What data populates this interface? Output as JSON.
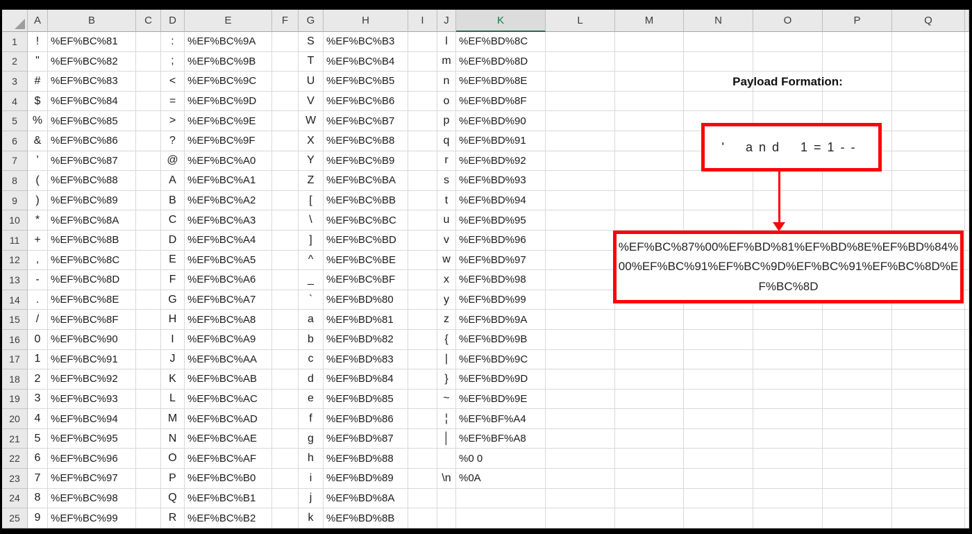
{
  "sheet": {
    "columns": [
      "A",
      "B",
      "C",
      "D",
      "E",
      "F",
      "G",
      "H",
      "I",
      "J",
      "K",
      "L",
      "M",
      "N",
      "O",
      "P",
      "Q"
    ],
    "selected_column": "K",
    "rows": [
      {
        "n": "1",
        "A": "!",
        "B": "%EF%BC%81",
        "D": ":",
        "E": "%EF%BC%9A",
        "G": "S",
        "H": "%EF%BC%B3",
        "J": "l",
        "K": "%EF%BD%8C"
      },
      {
        "n": "2",
        "A": "\"",
        "B": "%EF%BC%82",
        "D": ";",
        "E": "%EF%BC%9B",
        "G": "T",
        "H": "%EF%BC%B4",
        "J": "m",
        "K": "%EF%BD%8D"
      },
      {
        "n": "3",
        "A": "#",
        "B": "%EF%BC%83",
        "D": "<",
        "E": "%EF%BC%9C",
        "G": "U",
        "H": "%EF%BC%B5",
        "J": "n",
        "K": "%EF%BD%8E"
      },
      {
        "n": "4",
        "A": "$",
        "B": "%EF%BC%84",
        "D": "=",
        "E": "%EF%BC%9D",
        "G": "V",
        "H": "%EF%BC%B6",
        "J": "o",
        "K": "%EF%BD%8F"
      },
      {
        "n": "5",
        "A": "%",
        "B": "%EF%BC%85",
        "D": ">",
        "E": "%EF%BC%9E",
        "G": "W",
        "H": "%EF%BC%B7",
        "J": "p",
        "K": "%EF%BD%90"
      },
      {
        "n": "6",
        "A": "&",
        "B": "%EF%BC%86",
        "D": "?",
        "E": "%EF%BC%9F",
        "G": "X",
        "H": "%EF%BC%B8",
        "J": "q",
        "K": "%EF%BD%91"
      },
      {
        "n": "7",
        "A": "'",
        "B": "%EF%BC%87",
        "D": "@",
        "E": "%EF%BC%A0",
        "G": "Y",
        "H": "%EF%BC%B9",
        "J": "r",
        "K": "%EF%BD%92"
      },
      {
        "n": "8",
        "A": "(",
        "B": "%EF%BC%88",
        "D": "A",
        "E": "%EF%BC%A1",
        "G": "Z",
        "H": "%EF%BC%BA",
        "J": "s",
        "K": "%EF%BD%93"
      },
      {
        "n": "9",
        "A": ")",
        "B": "%EF%BC%89",
        "D": "B",
        "E": "%EF%BC%A2",
        "G": "[",
        "H": "%EF%BC%BB",
        "J": "t",
        "K": "%EF%BD%94"
      },
      {
        "n": "10",
        "A": "*",
        "B": "%EF%BC%8A",
        "D": "C",
        "E": "%EF%BC%A3",
        "G": "\\",
        "H": "%EF%BC%BC",
        "J": "u",
        "K": "%EF%BD%95"
      },
      {
        "n": "11",
        "A": "+",
        "B": "%EF%BC%8B",
        "D": "D",
        "E": "%EF%BC%A4",
        "G": "]",
        "H": "%EF%BC%BD",
        "J": "v",
        "K": "%EF%BD%96"
      },
      {
        "n": "12",
        "A": ",",
        "B": "%EF%BC%8C",
        "D": "E",
        "E": "%EF%BC%A5",
        "G": "^",
        "H": "%EF%BC%BE",
        "J": "w",
        "K": "%EF%BD%97"
      },
      {
        "n": "13",
        "A": "-",
        "B": "%EF%BC%8D",
        "D": "F",
        "E": "%EF%BC%A6",
        "G": "_",
        "H": "%EF%BC%BF",
        "J": "x",
        "K": "%EF%BD%98"
      },
      {
        "n": "14",
        "A": ".",
        "B": "%EF%BC%8E",
        "D": "G",
        "E": "%EF%BC%A7",
        "G": "`",
        "H": "%EF%BD%80",
        "J": "y",
        "K": "%EF%BD%99"
      },
      {
        "n": "15",
        "A": "/",
        "B": "%EF%BC%8F",
        "D": "H",
        "E": "%EF%BC%A8",
        "G": "a",
        "H": "%EF%BD%81",
        "J": "z",
        "K": "%EF%BD%9A"
      },
      {
        "n": "16",
        "A": "0",
        "B": "%EF%BC%90",
        "D": "I",
        "E": "%EF%BC%A9",
        "G": "b",
        "H": "%EF%BD%82",
        "J": "{",
        "K": "%EF%BD%9B"
      },
      {
        "n": "17",
        "A": "1",
        "B": "%EF%BC%91",
        "D": "J",
        "E": "%EF%BC%AA",
        "G": "c",
        "H": "%EF%BD%83",
        "J": "|",
        "K": "%EF%BD%9C"
      },
      {
        "n": "18",
        "A": "2",
        "B": "%EF%BC%92",
        "D": "K",
        "E": "%EF%BC%AB",
        "G": "d",
        "H": "%EF%BD%84",
        "J": "}",
        "K": "%EF%BD%9D"
      },
      {
        "n": "19",
        "A": "3",
        "B": "%EF%BC%93",
        "D": "L",
        "E": "%EF%BC%AC",
        "G": "e",
        "H": "%EF%BD%85",
        "J": "~",
        "K": "%EF%BD%9E"
      },
      {
        "n": "20",
        "A": "4",
        "B": "%EF%BC%94",
        "D": "M",
        "E": "%EF%BC%AD",
        "G": "f",
        "H": "%EF%BD%86",
        "J": "¦",
        "K": "%EF%BF%A4"
      },
      {
        "n": "21",
        "A": "5",
        "B": "%EF%BC%95",
        "D": "N",
        "E": "%EF%BC%AE",
        "G": "g",
        "H": "%EF%BD%87",
        "J": "│",
        "K": "%EF%BF%A8"
      },
      {
        "n": "22",
        "A": "6",
        "B": "%EF%BC%96",
        "D": "O",
        "E": "%EF%BC%AF",
        "G": "h",
        "H": "%EF%BD%88",
        "J": "",
        "K": "%0 0"
      },
      {
        "n": "23",
        "A": "7",
        "B": "%EF%BC%97",
        "D": "P",
        "E": "%EF%BC%B0",
        "G": "i",
        "H": "%EF%BD%89",
        "J": "\\n",
        "K": "%0A"
      },
      {
        "n": "24",
        "A": "8",
        "B": "%EF%BC%98",
        "D": "Q",
        "E": "%EF%BC%B1",
        "G": "j",
        "H": "%EF%BD%8A",
        "J": "",
        "K": ""
      },
      {
        "n": "25",
        "A": "9",
        "B": "%EF%BC%99",
        "D": "R",
        "E": "%EF%BC%B2",
        "G": "k",
        "H": "%EF%BD%8B",
        "J": "",
        "K": ""
      }
    ]
  },
  "annotation": {
    "title": "Payload Formation:",
    "payload_text": "' and 1=1--",
    "payload_encoded": "%EF%BC%87%00%EF%BD%81%EF%BD%8E%EF%BD%84%00%EF%BC%91%EF%BC%9D%EF%BC%91%EF%BC%8D%EF%BC%8D"
  },
  "colors": {
    "accent_red": "#fb0505",
    "selected_green": "#217346",
    "header_gray": "#e9e9e9",
    "gridline": "#d9d9d9"
  }
}
